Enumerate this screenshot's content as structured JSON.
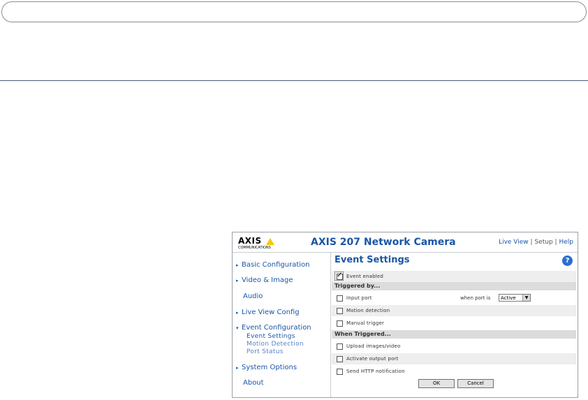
{
  "camera": {
    "logo_text": "AXIS",
    "logo_subtext": "COMMUNICATIONS",
    "title": "AXIS 207 Network Camera",
    "links": [
      {
        "label": "Live View"
      },
      {
        "label": "Setup"
      },
      {
        "label": "Help"
      }
    ],
    "separator": "|"
  },
  "sidebar": {
    "items": [
      {
        "label": "Basic Configuration",
        "expander": "▸"
      },
      {
        "label": "Video & Image",
        "expander": "▸"
      },
      {
        "label": "Audio"
      },
      {
        "label": "Live View Config",
        "expander": "▸"
      },
      {
        "label": "Event Configuration",
        "expander": "▾"
      },
      {
        "label": "System Options",
        "expander": "▸"
      },
      {
        "label": "About"
      }
    ],
    "subitems": [
      {
        "label": "Event Settings",
        "active": true
      },
      {
        "label": "Motion Detection"
      },
      {
        "label": "Port Status"
      }
    ]
  },
  "main": {
    "title": "Event Settings",
    "help_glyph": "?",
    "event_enabled": {
      "label": "Event enabled",
      "checked": true
    },
    "triggered_by": {
      "heading": "Triggered by...",
      "input_port": {
        "label": "Input port",
        "checked": false,
        "port_label": "when port is",
        "port_value": "Active"
      },
      "motion": {
        "label": "Motion detection",
        "checked": false
      },
      "manual": {
        "label": "Manual trigger",
        "checked": false
      }
    },
    "when_triggered": {
      "heading": "When Triggered...",
      "upload": {
        "label": "Upload images/video",
        "checked": false
      },
      "output": {
        "label": "Activate output port",
        "checked": false
      },
      "http": {
        "label": "Send HTTP notification",
        "checked": false
      }
    },
    "buttons": {
      "ok": "OK",
      "cancel": "Cancel"
    }
  }
}
